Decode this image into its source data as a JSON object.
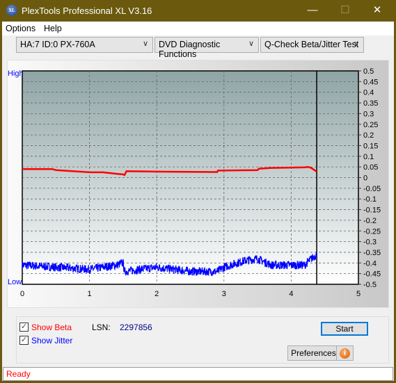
{
  "window": {
    "title": "PlexTools Professional XL V3.16",
    "logo_text": "XL",
    "minimize": "—",
    "maximize": "☐",
    "close": "✕",
    "titlebar_color": "#6b5a0e"
  },
  "menu": [
    {
      "label": "Options"
    },
    {
      "label": "Help"
    }
  ],
  "toolbar": {
    "drive": "HA:7 ID:0  PX-760A",
    "function": "DVD Diagnostic Functions",
    "test": "Q-Check Beta/Jitter Test"
  },
  "chart_data": {
    "type": "line",
    "ylabel_high": "High",
    "ylabel_low": "Low",
    "xlim": [
      0,
      5
    ],
    "ylim": [
      -0.5,
      0.5
    ],
    "xticks": [
      "0",
      "1",
      "2",
      "3",
      "4",
      "5"
    ],
    "yticks": [
      "0.5",
      "0.45",
      "0.4",
      "0.35",
      "0.3",
      "0.25",
      "0.2",
      "0.15",
      "0.1",
      "0.05",
      "0",
      "-0.05",
      "-0.1",
      "-0.15",
      "-0.2",
      "-0.25",
      "-0.3",
      "-0.35",
      "-0.4",
      "-0.45",
      "-0.5"
    ],
    "grid": true,
    "marker_x": 4.38,
    "series": [
      {
        "name": "Beta",
        "color": "#ff0000",
        "x": [
          0,
          0.45,
          0.5,
          1,
          1.2,
          1.4,
          1.5,
          1.52,
          1.55,
          2,
          2.5,
          2.9,
          2.91,
          3.5,
          3.52,
          3.7,
          4.0,
          4.2,
          4.25,
          4.3,
          4.38
        ],
        "y": [
          0.04,
          0.04,
          0.035,
          0.025,
          0.025,
          0.018,
          0.015,
          0.012,
          0.03,
          0.028,
          0.027,
          0.026,
          0.033,
          0.035,
          0.042,
          0.045,
          0.047,
          0.048,
          0.05,
          0.045,
          0.028
        ]
      },
      {
        "name": "Jitter",
        "color": "#0000ff",
        "x": [
          0,
          0.5,
          1,
          1.4,
          1.5,
          1.52,
          2,
          2.5,
          2.9,
          3.0,
          3.3,
          3.5,
          3.7,
          4.0,
          4.2,
          4.3,
          4.38
        ],
        "y": [
          -0.41,
          -0.42,
          -0.43,
          -0.41,
          -0.4,
          -0.44,
          -0.42,
          -0.44,
          -0.44,
          -0.42,
          -0.39,
          -0.38,
          -0.41,
          -0.41,
          -0.41,
          -0.38,
          -0.36
        ]
      }
    ]
  },
  "controls": {
    "show_beta": "Show Beta",
    "show_jitter": "Show Jitter",
    "show_beta_checked": true,
    "show_jitter_checked": true,
    "lsn_label": "LSN:",
    "lsn_value": "2297856",
    "start": "Start",
    "preferences": "Preferences",
    "info_icon": "i"
  },
  "status": {
    "text": "Ready"
  }
}
